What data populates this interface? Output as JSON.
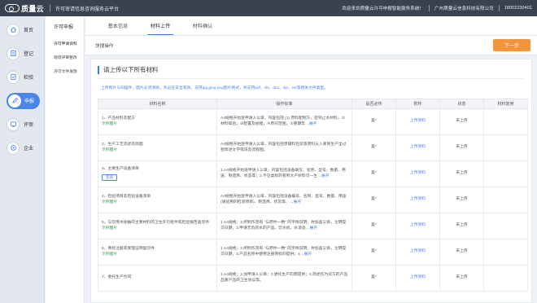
{
  "header": {
    "logo_text": "质量云",
    "title": "许可审请信息咨询服务云平台",
    "welcome": "欢迎来到质量云许可申报智能服务系统！",
    "company": "广州质量云信息科技有限公司",
    "phone": "18002230401"
  },
  "sidebar": {
    "items": [
      {
        "label": "首页",
        "icon": "home-icon"
      },
      {
        "label": "登记",
        "icon": "register-icon"
      },
      {
        "label": "检验",
        "icon": "inspect-icon"
      },
      {
        "label": "申报",
        "icon": "declare-icon"
      },
      {
        "label": "评审",
        "icon": "review-icon"
      },
      {
        "label": "企业",
        "icon": "enterprise-icon"
      }
    ],
    "active_index": 3
  },
  "subnav": {
    "title": "许可申报",
    "items": [
      "许可申请资料",
      "现场评审整改",
      "许可文件发放"
    ]
  },
  "tabs": [
    {
      "label": "基本信息"
    },
    {
      "label": "材料上传"
    },
    {
      "label": "材料确认"
    }
  ],
  "active_tab": 1,
  "actionbar": {
    "label": "快捷操作",
    "next_label": "下一步"
  },
  "card": {
    "title": "请上传以下所有材料",
    "hint": "上传照片与扫描件，图片必须清晰，务必在安全有效、支持jpg.jpeg.png图片格式，并支持pdf、xls、doc、zip、rar等相关文件类型。"
  },
  "table": {
    "headers": [
      "材料名称",
      "操作标准",
      "是否必传",
      "附件",
      "状态",
      "材料复用"
    ],
    "rows": [
      {
        "name": "1、产品材料及配方",
        "example": "示例图片",
        "button": "",
        "standard": "A4规格开始逐申请人公章，内容包括 (1) 原料配制方，密到止水材料，②材料碎后，③配置及规模，④原司范围，⑤使期年",
        "expand": "展开",
        "required": "是",
        "attachment": "上传资料",
        "status": "未上传",
        "reuse": ""
      },
      {
        "name": "2、生产工艺流述及简图",
        "example": "示例图片",
        "button": "",
        "standard": "A4规格开始逐申请人公章，内容包括原辅料包装等原料从入库到生产全过程简述文学或说及流程图。",
        "expand": "",
        "required": "是",
        "attachment": "上传资料",
        "status": "未上传",
        "reuse": ""
      },
      {
        "name": "3、主要生产设备清单",
        "example": "",
        "button": "空表",
        "standard": "1.A4规格开始逐申请人公章，内容包括设备填写、名称、型号、数量、用途、制造商、状态等；2.不见类标的有所大产材料可一生",
        "expand": "展开",
        "required": "是",
        "attachment": "上传资料",
        "status": "未上传",
        "reuse": ""
      },
      {
        "name": "4、检验项目及检验设备清单",
        "example": "示例图片",
        "button": "",
        "standard": "A4规格开始逐申请人公章，内容包括设备编号、名称、型号、数量、用途(请验用的检测项目)、制造商、状态等、",
        "expand": "展开",
        "required": "是",
        "attachment": "上传资料",
        "status": "未上传",
        "reuse": ""
      },
      {
        "name": "5、与饮用水接触的主要材料的卫生许可批件或检验报告复印件",
        "example": "示例图片",
        "button": "",
        "standard": "1.A4规格；2.所制作须有 \"与原件一致\" 的字样说明，并加盖公章，注明提交日期；3.申请无负的水的产品、饮水机、水溶处",
        "expand": "展开",
        "required": "是",
        "attachment": "上传资料",
        "status": "未上传",
        "reuse": ""
      },
      {
        "name": "6、商标注册或受理证明复印件",
        "example": "示例图片",
        "button": "",
        "standard": "1.A4规格；2.所制作须有 \"与原件一致\" 的字样说明，并加盖公章，注明提交日期；3.产品名称中使用注册商标的提供；4",
        "expand": "展开",
        "required": "是",
        "attachment": "上传资料",
        "status": "未上传",
        "reuse": ""
      },
      {
        "name": "7、委托生产合同",
        "example": "",
        "button": "",
        "standard": "1.A4规格；2.加申请人公章；3.委托生产的需提供；4.简述作为双方的产品品质产品的卫生协议等。",
        "expand": "",
        "required": "是",
        "attachment": "上传资料",
        "status": "未上传",
        "reuse": ""
      }
    ]
  },
  "colors": {
    "topbar": "#3a4250",
    "accent": "#3b7ddd",
    "next_button": "#f5953b",
    "example_link": "#3d9a5a",
    "required_star": "#e54545"
  }
}
